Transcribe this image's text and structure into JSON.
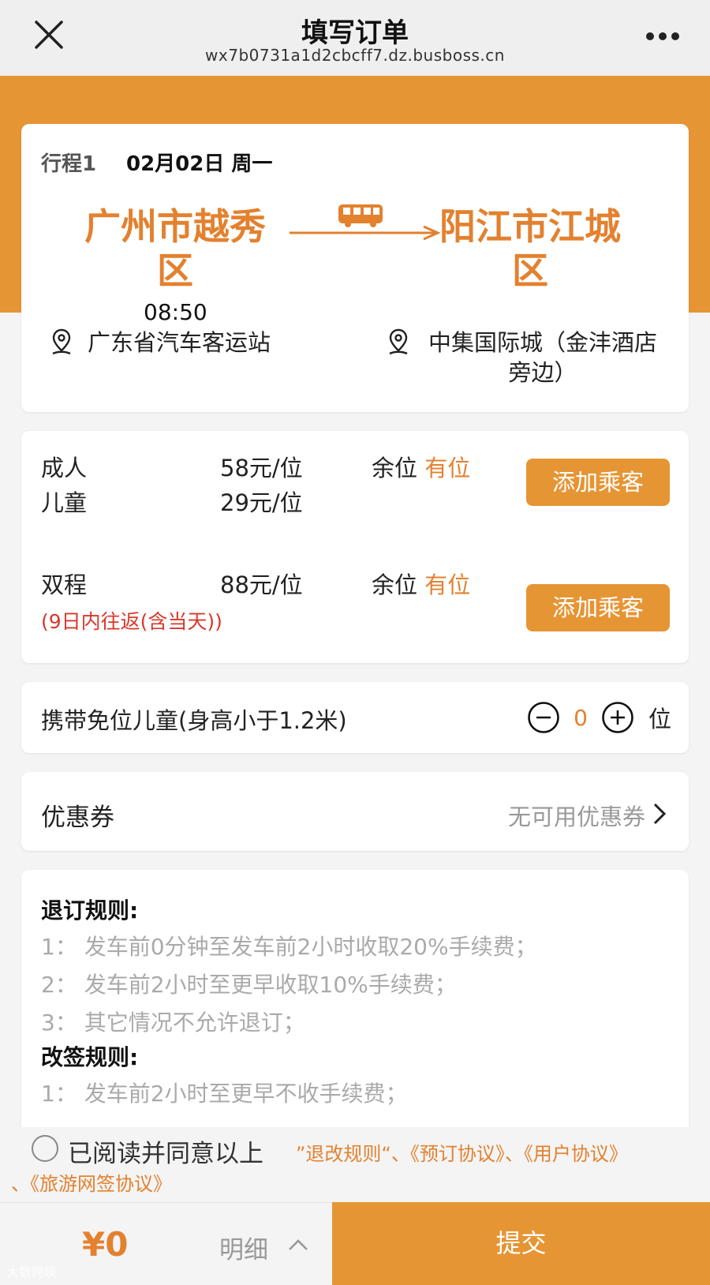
{
  "nav": {
    "title": "填写订单",
    "subtitle": "wx7b0731a1d2cbcff7.dz.busboss.cn"
  },
  "trip": {
    "label": "行程1",
    "date": "02月02日 周一",
    "from_city_line1": "广州市越秀",
    "from_city_line2": "区",
    "to_city_line1": "阳江市江城",
    "to_city_line2": "区",
    "time": "08:50",
    "from_stop": "广东省汽车客运站",
    "to_stop": "中集国际城（金沣酒店旁边）"
  },
  "prices": {
    "adult_label": "成人",
    "adult_price": "58元/位",
    "child_label": "儿童",
    "child_price": "29元/位",
    "seat_label": "余位",
    "seat_status": "有位",
    "roundtrip_label": "双程",
    "roundtrip_price": "88元/位",
    "roundtrip_note": "(9日内往返(含当天))",
    "add_button": "添加乘客"
  },
  "free_child": {
    "label": "携带免位儿童(身高小于1.2米)",
    "count": "0",
    "unit": "位"
  },
  "coupon": {
    "label": "优惠券",
    "value": "无可用优惠券"
  },
  "rules": {
    "refund_title": "退订规则:",
    "refund": [
      "1：  发车前0分钟至发车前2小时收取20%手续费；",
      "2：  发车前2小时至更早收取10%手续费；",
      "3：  其它情况不允许退订；"
    ],
    "change_title": "改签规则:",
    "change": [
      "1：  发车前2小时至更早不收手续费；"
    ]
  },
  "agreement": {
    "text": "已阅读并同意以上",
    "links_line1": "”退改规则“、《预订协议》、《用户协议》",
    "links_line2": "、《旅游网签协议》"
  },
  "bottom": {
    "price": "¥0",
    "detail": "明细",
    "submit": "提交"
  },
  "watermark": "大数跨境",
  "colors": {
    "accent": "#e69534",
    "city": "#e3812f",
    "note_red": "#d9382b"
  }
}
